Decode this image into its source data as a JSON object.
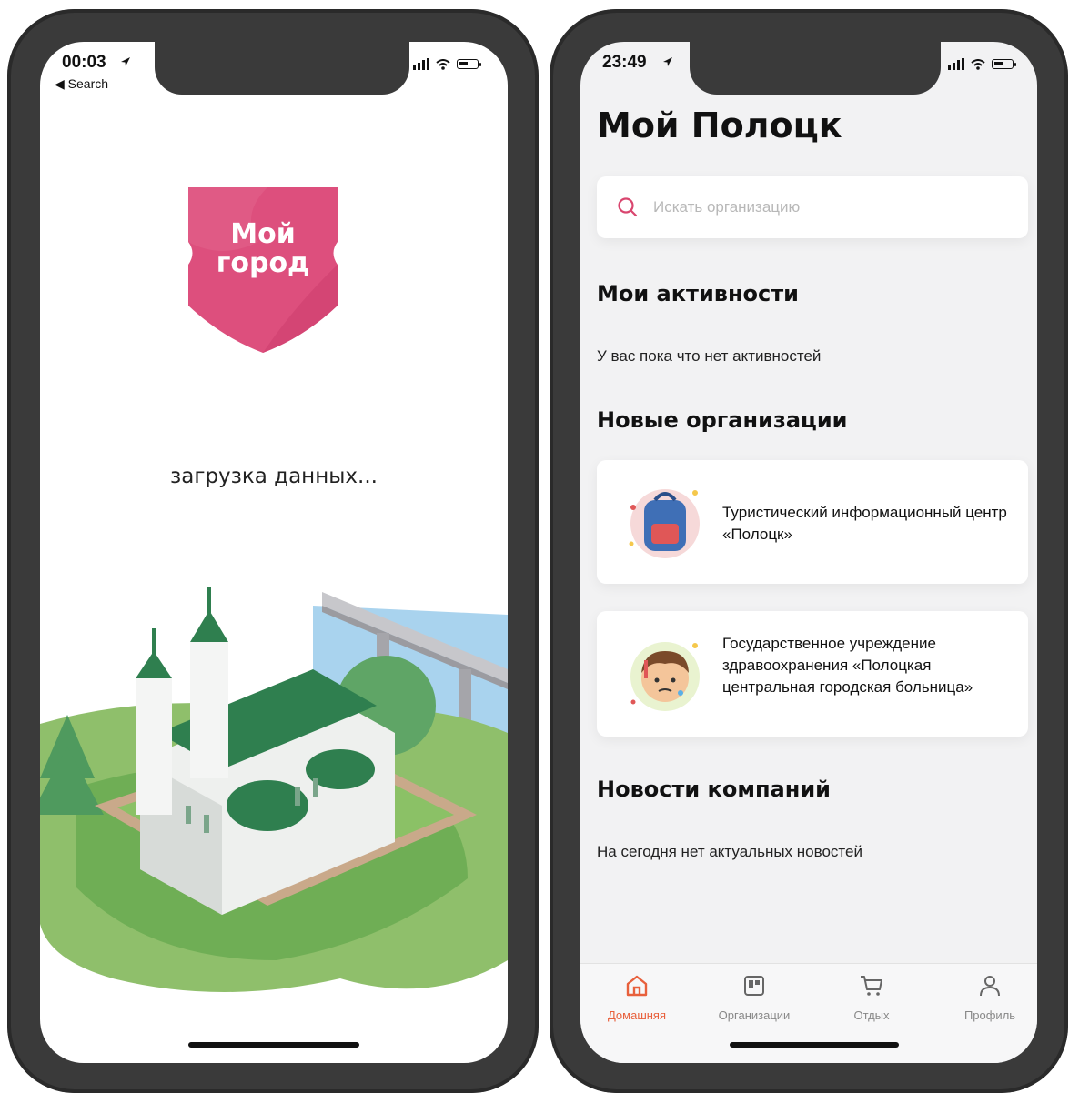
{
  "left_phone": {
    "status": {
      "time": "00:03",
      "back_label": "Search"
    },
    "logo": {
      "line1": "Мой",
      "line2": "город",
      "color": "#dd4f7d"
    },
    "loading_text": "загрузка данных..."
  },
  "right_phone": {
    "status": {
      "time": "23:49"
    },
    "title": "Мой Полоцк",
    "search": {
      "placeholder": "Искать организацию",
      "icon": "search-icon"
    },
    "activities": {
      "heading": "Мои активности",
      "empty_text": "У вас пока что нет активностей"
    },
    "new_orgs": {
      "heading": "Новые организации",
      "items": [
        {
          "name": "Туристический информационный центр «Полоцк»",
          "icon": "backpack-icon"
        },
        {
          "name": "Государственное учреждение здравоохранения «Полоцкая центральная городская больница»",
          "icon": "sick-person-icon"
        }
      ]
    },
    "news": {
      "heading": "Новости компаний",
      "empty_text": "На сегодня нет актуальных новостей"
    },
    "tabbar": {
      "items": [
        {
          "label": "Домашняя",
          "icon": "home-icon",
          "active": true
        },
        {
          "label": "Организации",
          "icon": "board-icon",
          "active": false
        },
        {
          "label": "Отдых",
          "icon": "cart-icon",
          "active": false
        },
        {
          "label": "Профиль",
          "icon": "person-icon",
          "active": false
        }
      ]
    },
    "accent_color": "#e8603c"
  }
}
